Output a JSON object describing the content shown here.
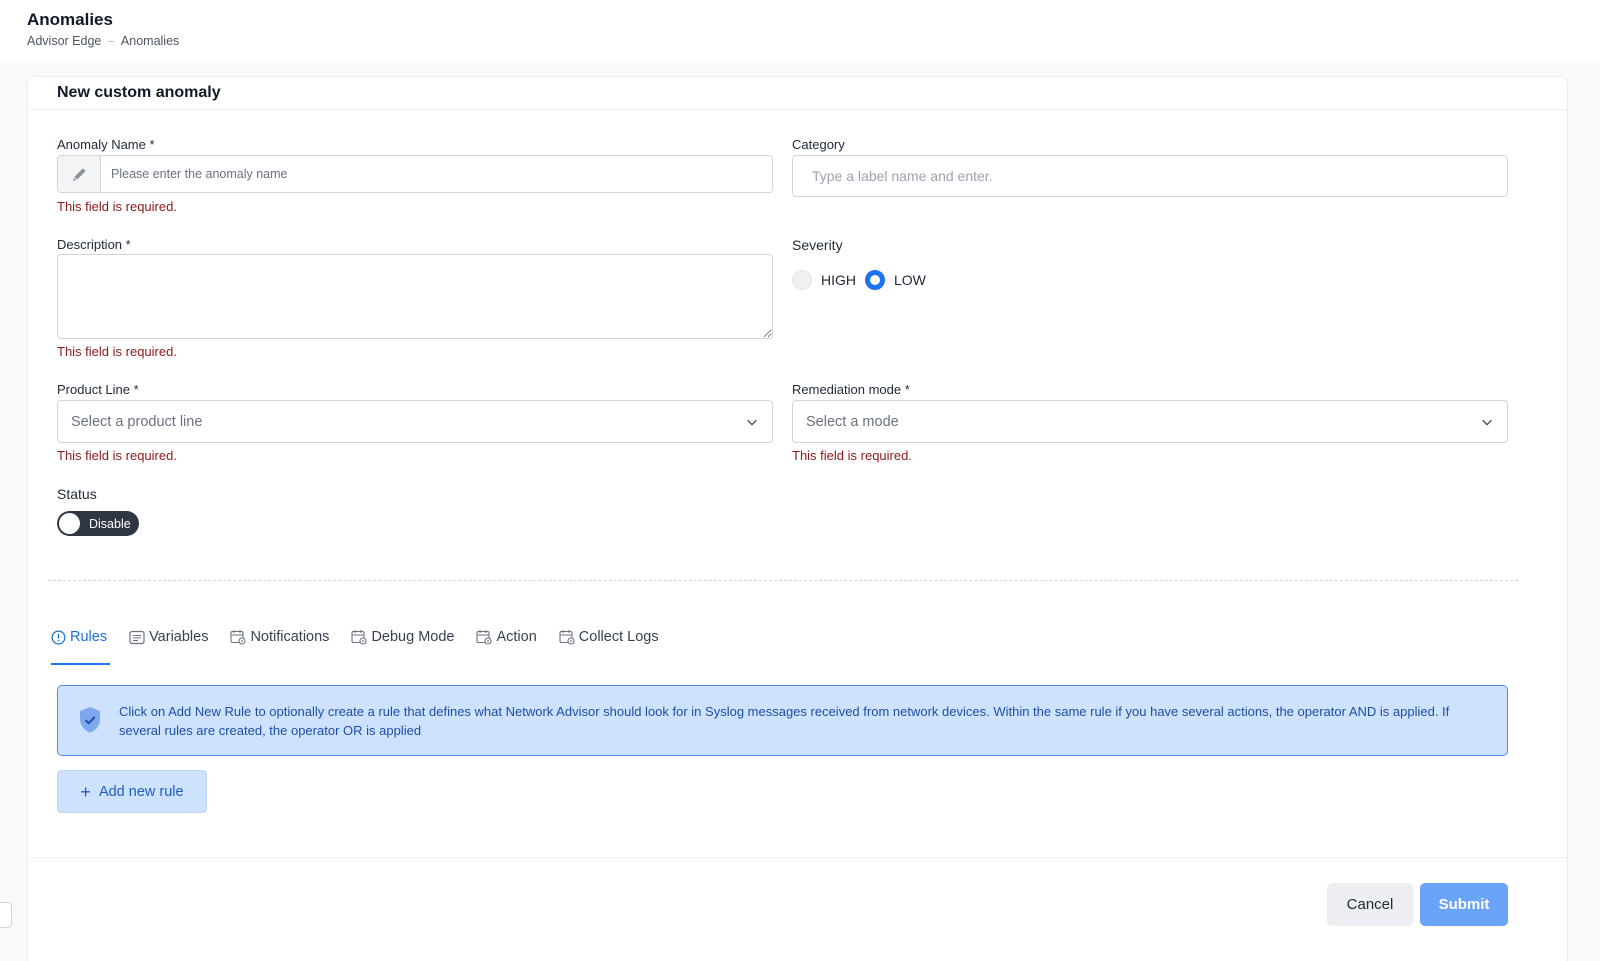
{
  "header": {
    "title": "Anomalies",
    "breadcrumb": [
      "Advisor Edge",
      "Anomalies"
    ]
  },
  "form": {
    "card_title": "New custom anomaly",
    "anomaly_name": {
      "label": "Anomaly Name *",
      "placeholder": "Please enter the anomaly name",
      "value": "",
      "icon": "pencil-icon",
      "error": "This field is required."
    },
    "category": {
      "label": "Category",
      "placeholder": "Type a label name and enter.",
      "value": ""
    },
    "description": {
      "label": "Description *",
      "value": "",
      "error": "This field is required."
    },
    "severity": {
      "label": "Severity",
      "options": [
        "HIGH",
        "LOW"
      ],
      "selected": "LOW"
    },
    "product_line": {
      "label": "Product Line *",
      "placeholder": "Select a product line",
      "error": "This field is required."
    },
    "remediation_mode": {
      "label": "Remediation mode *",
      "placeholder": "Select a mode",
      "error": "This field is required."
    },
    "status": {
      "label": "Status",
      "toggle_label": "Disable",
      "enabled": false
    }
  },
  "tabs": [
    {
      "label": "Rules",
      "icon": "alert-circle-icon",
      "active": true
    },
    {
      "label": "Variables",
      "icon": "list-box-icon",
      "active": false
    },
    {
      "label": "Notifications",
      "icon": "calendar-gear-icon",
      "active": false
    },
    {
      "label": "Debug Mode",
      "icon": "calendar-gear-icon",
      "active": false
    },
    {
      "label": "Action",
      "icon": "calendar-gear-icon",
      "active": false
    },
    {
      "label": "Collect Logs",
      "icon": "calendar-gear-icon",
      "active": false
    }
  ],
  "rules": {
    "info_icon": "shield-check-icon",
    "info_text": "Click on Add New Rule to optionally create a rule that defines what Network Advisor should look for in Syslog messages received from network devices. Within the same rule if you have several actions, the operator AND is applied. If several rules are created, the operator OR is applied",
    "add_button": "Add new rule"
  },
  "footer": {
    "cancel": "Cancel",
    "submit": "Submit"
  },
  "colors": {
    "accent": "#1d72f3",
    "error": "#8b1a1a",
    "info_bg": "#cfe2fd",
    "submit_bg": "#6aa4f8"
  }
}
